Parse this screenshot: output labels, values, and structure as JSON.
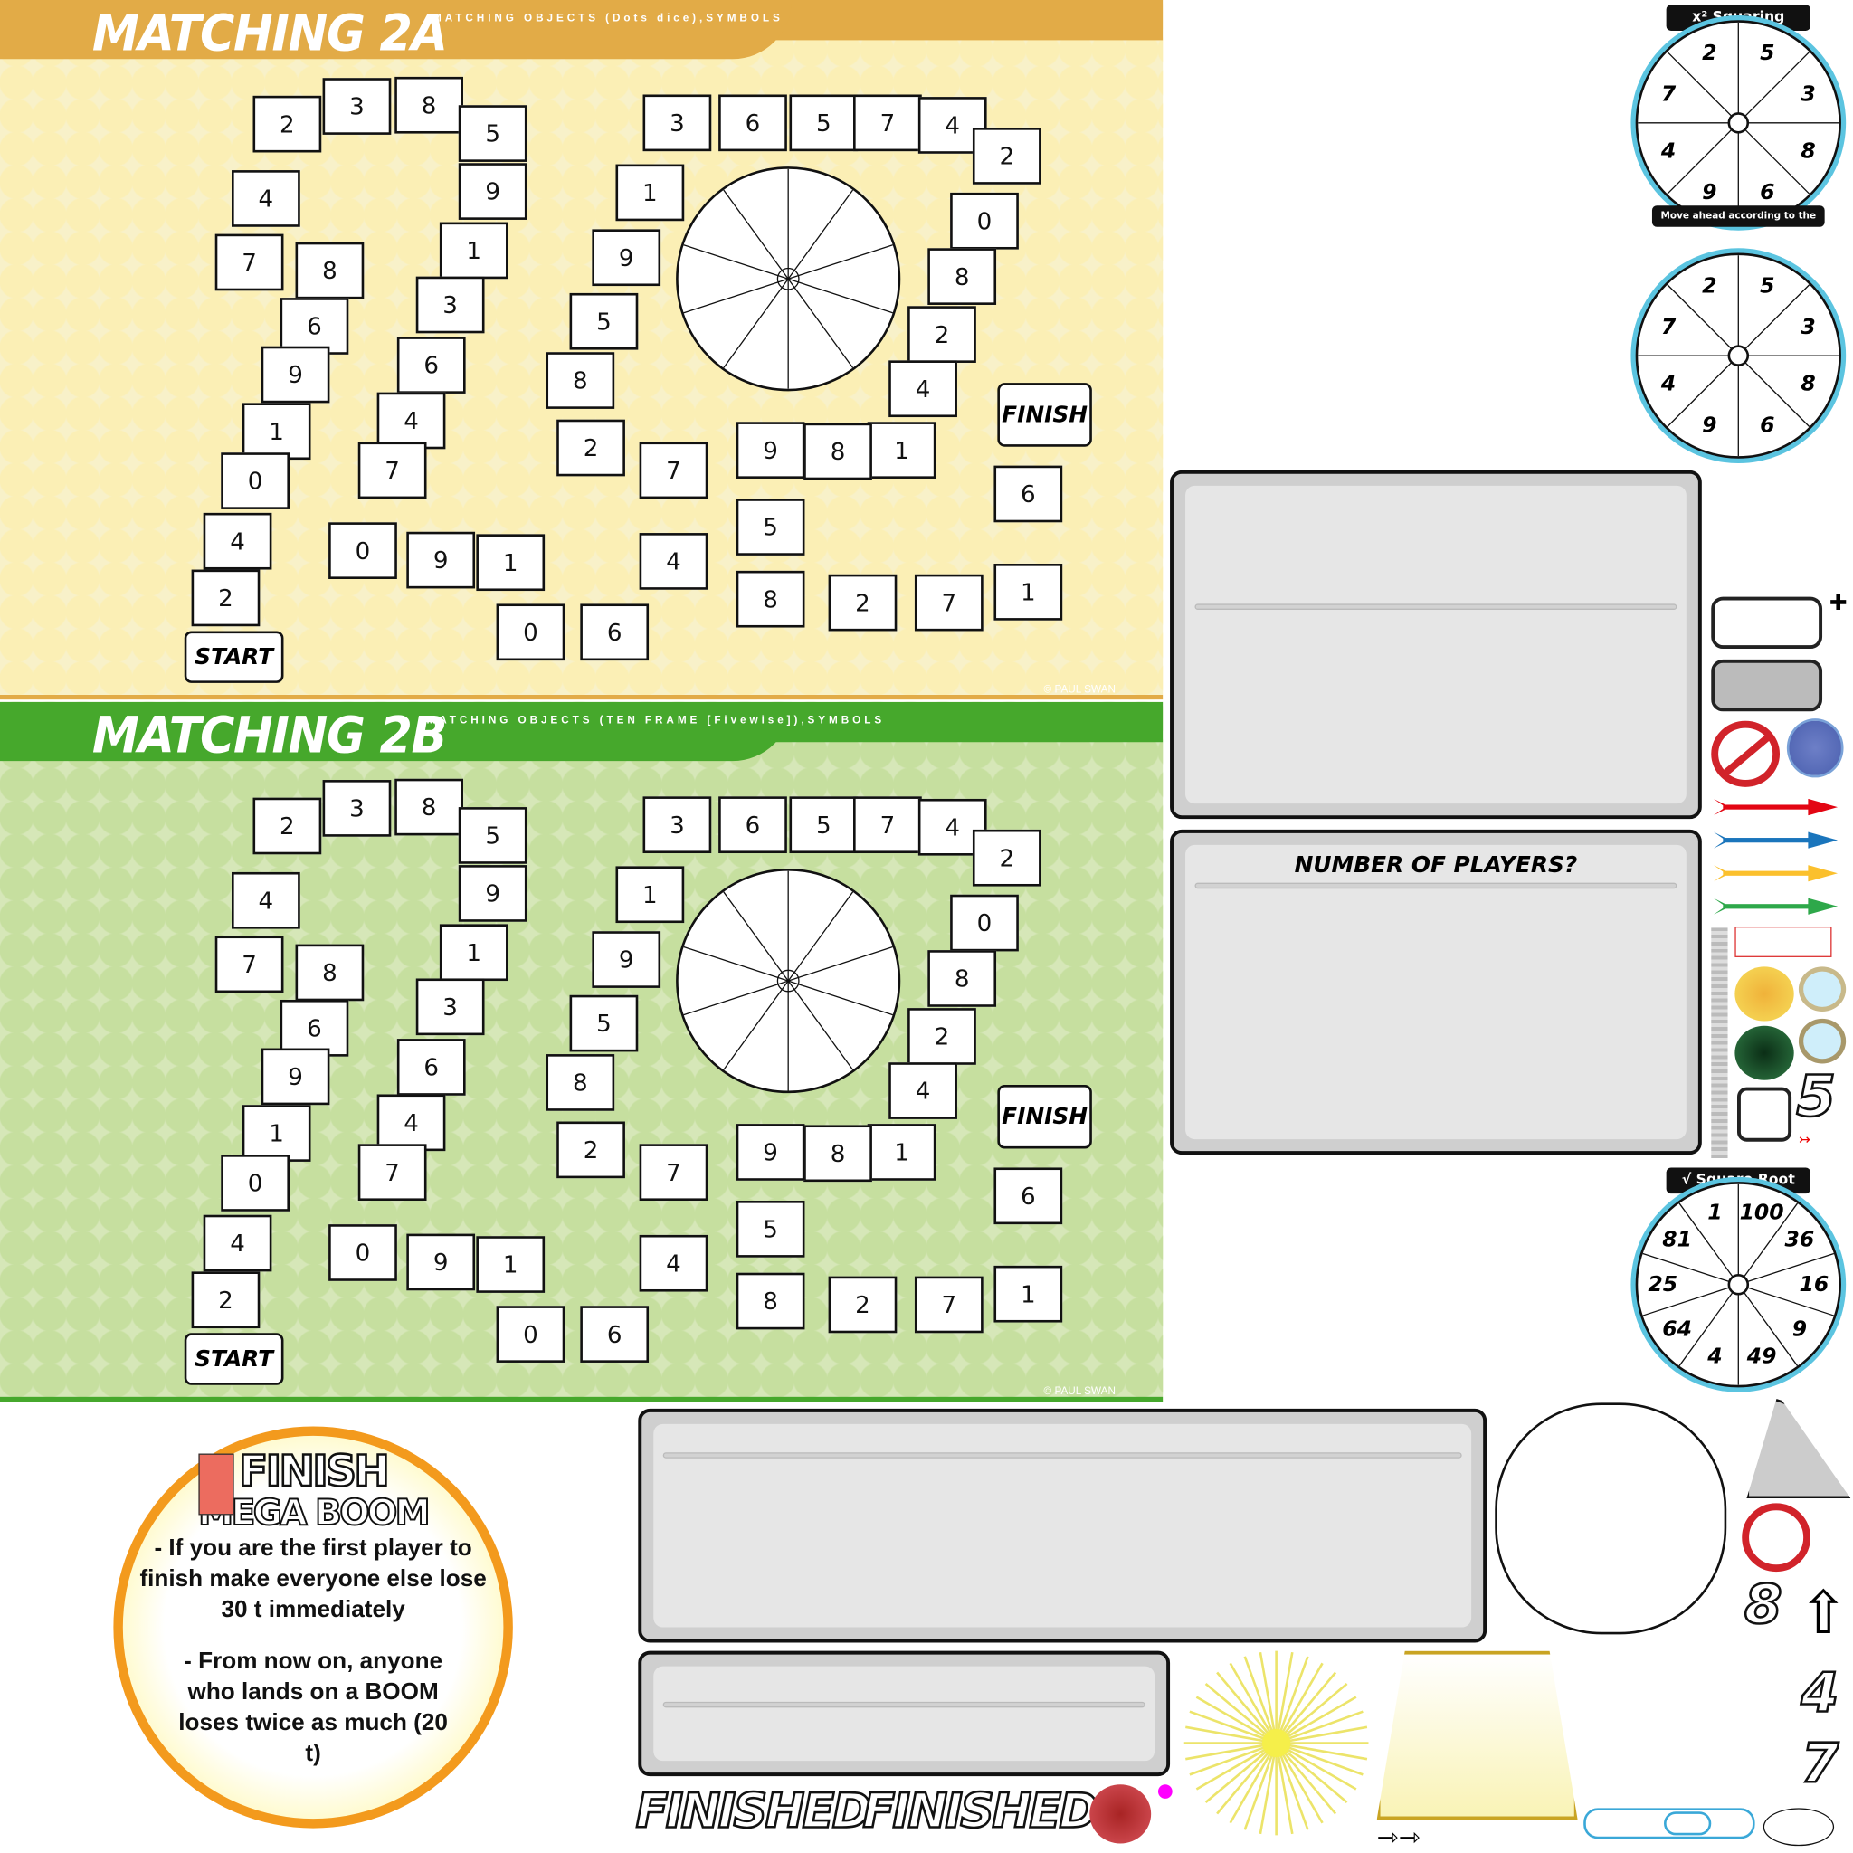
{
  "boards": [
    {
      "title": "MATCHING 2A",
      "subtitle": "MATCHING OBJECTS (Dots dice),SYMBOLS",
      "start": "START",
      "finish": "FINISH",
      "copyright": "© PAUL SWAN",
      "header_color": "#e2ab47"
    },
    {
      "title": "MATCHING 2B",
      "subtitle": "MATCHING OBJECTS (TEN FRAME [Fivewise]),SYMBOLS",
      "start": "START",
      "finish": "FINISH",
      "copyright": "© PAUL SWAN",
      "header_color": "#46a82c"
    }
  ],
  "track_numbers": [
    "2",
    "3",
    "8",
    "5",
    "4",
    "9",
    "7",
    "8",
    "1",
    "6",
    "3",
    "9",
    "6",
    "1",
    "4",
    "0",
    "7",
    "4",
    "0",
    "9",
    "2",
    "1",
    "0",
    "6",
    "4",
    "7",
    "2",
    "8",
    "5",
    "9",
    "1",
    "3",
    "6",
    "5",
    "7",
    "4",
    "2",
    "0",
    "8",
    "2",
    "4",
    "1",
    "8",
    "9",
    "5",
    "8",
    "2",
    "7",
    "1",
    "6"
  ],
  "spinners": {
    "squaring": {
      "title": "x² Squaring",
      "footer": "Move ahead according to the ones digit",
      "numbers": [
        "5",
        "3",
        "8",
        "6",
        "9",
        "4",
        "7",
        "2"
      ]
    },
    "plain": {
      "numbers": [
        "5",
        "3",
        "8",
        "6",
        "9",
        "4",
        "7",
        "2"
      ]
    },
    "square_root": {
      "title": "√ Square Root",
      "numbers": [
        "100",
        "36",
        "16",
        "9",
        "49",
        "4",
        "64",
        "25",
        "81",
        "1"
      ]
    }
  },
  "players_panel": {
    "title": "NUMBER OF PLAYERS?"
  },
  "boom_card": {
    "title": "FINISH",
    "subtitle": "MEGA BOOM",
    "rule1": "- If you are the first player to finish make everyone else lose 30 t immediately",
    "rule2": "- From now on, anyone who lands on a BOOM loses twice as much (20 t)"
  },
  "finished_labels": [
    "FINISHED",
    "FINISHED"
  ],
  "side_icons": {
    "numbers": [
      "5",
      "8",
      "4",
      "7"
    ]
  },
  "arrow_colors": [
    "#e30613",
    "#1a75bc",
    "#fbc02d",
    "#2ea84a"
  ]
}
